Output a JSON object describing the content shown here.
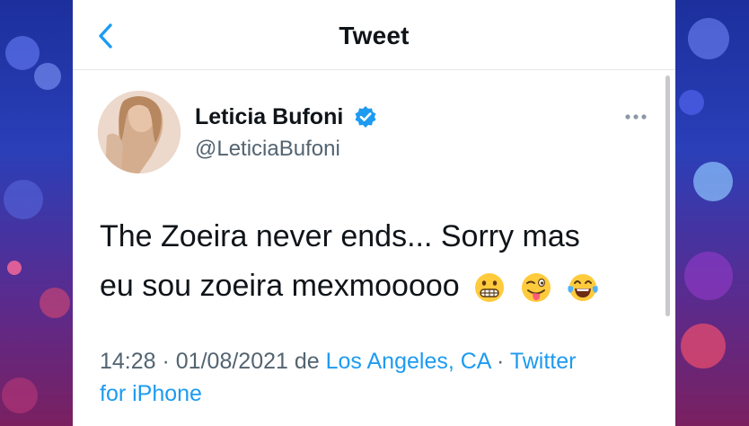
{
  "header": {
    "title": "Tweet",
    "back_icon": "chevron-left-icon"
  },
  "tweet": {
    "author_name": "Leticia Bufoni",
    "author_handle": "@LeticiaBufoni",
    "verified": true,
    "text_line1": "The Zoeira never ends... Sorry mas",
    "text_line2": "eu sou zoeira mexmooooo",
    "emojis": [
      "grimacing-face-emoji",
      "winking-tongue-face-emoji",
      "tears-of-joy-emoji"
    ],
    "time": "14:28",
    "separator": " · ",
    "date": "01/08/2021",
    "de": "de",
    "location": "Los Angeles, CA",
    "source_part1": "Twitter",
    "source_part2": "for iPhone"
  },
  "colors": {
    "accent": "#1d9bf0",
    "text": "#0f1419",
    "secondary": "#536471"
  }
}
